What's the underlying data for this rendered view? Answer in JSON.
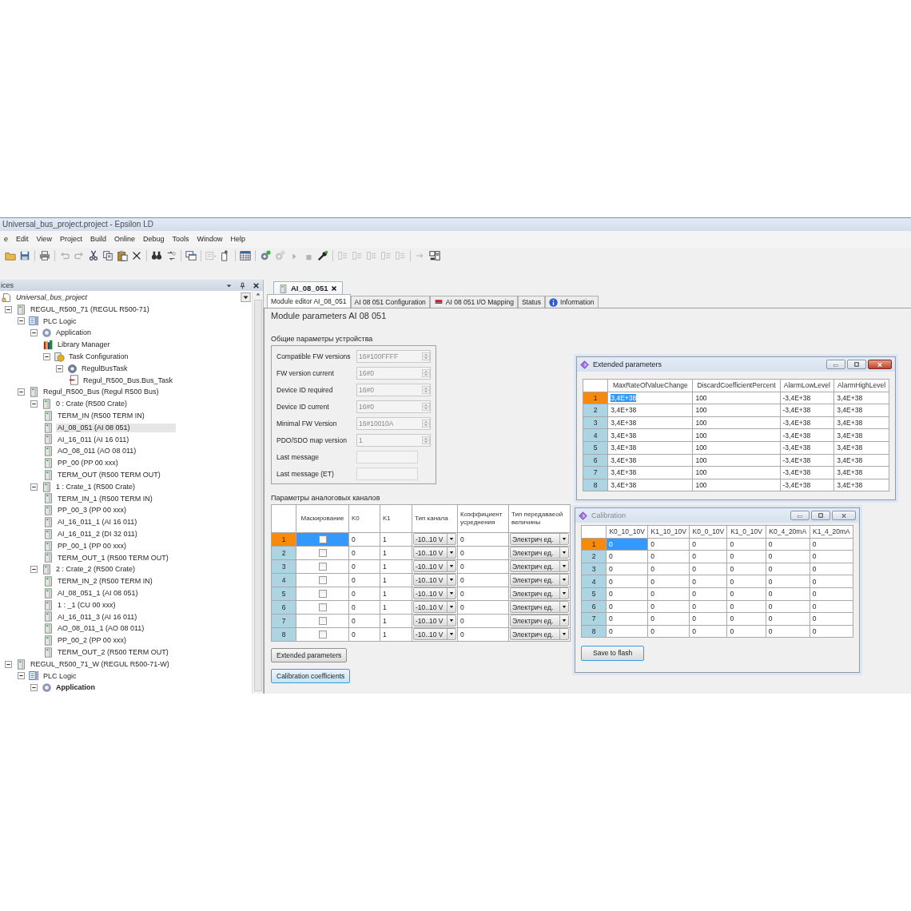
{
  "window": {
    "title": "Universal_bus_project.project - Epsilon LD"
  },
  "menu": [
    "e",
    "Edit",
    "View",
    "Project",
    "Build",
    "Online",
    "Debug",
    "Tools",
    "Window",
    "Help"
  ],
  "toolbar": [
    {
      "kind": "open",
      "disabled": false
    },
    {
      "kind": "save",
      "disabled": false
    },
    {
      "kind": "sep"
    },
    {
      "kind": "print",
      "disabled": false
    },
    {
      "kind": "sep"
    },
    {
      "kind": "undo",
      "disabled": true
    },
    {
      "kind": "redo",
      "disabled": true
    },
    {
      "kind": "cut",
      "disabled": false
    },
    {
      "kind": "copy",
      "disabled": false
    },
    {
      "kind": "paste",
      "disabled": false
    },
    {
      "kind": "delete",
      "disabled": false
    },
    {
      "kind": "sep"
    },
    {
      "kind": "find",
      "disabled": false
    },
    {
      "kind": "replace",
      "disabled": false
    },
    {
      "kind": "sep"
    },
    {
      "kind": "windows",
      "disabled": false
    },
    {
      "kind": "sep"
    },
    {
      "kind": "listdrop",
      "disabled": true
    },
    {
      "kind": "export",
      "disabled": false
    },
    {
      "kind": "sep"
    },
    {
      "kind": "grid",
      "disabled": false
    },
    {
      "kind": "sep"
    },
    {
      "kind": "build",
      "disabled": false
    },
    {
      "kind": "gear",
      "disabled": true
    },
    {
      "kind": "run",
      "disabled": true
    },
    {
      "kind": "stop",
      "disabled": true
    },
    {
      "kind": "wrench",
      "disabled": false
    },
    {
      "kind": "sep"
    },
    {
      "kind": "outline",
      "disabled": true
    },
    {
      "kind": "outline",
      "disabled": true
    },
    {
      "kind": "outline",
      "disabled": true
    },
    {
      "kind": "outline",
      "disabled": true
    },
    {
      "kind": "outline",
      "disabled": true
    },
    {
      "kind": "sep"
    },
    {
      "kind": "step",
      "disabled": true
    },
    {
      "kind": "network",
      "disabled": false
    }
  ],
  "devices_panel": {
    "title": "ices",
    "tree": [
      {
        "label": "Universal_bus_project",
        "kind": "project",
        "selected": false,
        "children": [
          {
            "label": "REGUL_R500_71 (REGUL R500-71)",
            "kind": "device",
            "selected": false,
            "expanded": true,
            "children": [
              {
                "label": "PLC Logic",
                "kind": "plc-logic",
                "selected": false,
                "expanded": true,
                "children": [
                  {
                    "label": "Application",
                    "kind": "application",
                    "selected": false,
                    "expanded": true,
                    "children": [
                      {
                        "label": "Library Manager",
                        "kind": "library",
                        "selected": false
                      },
                      {
                        "label": "Task Configuration",
                        "kind": "task-config",
                        "selected": false,
                        "expanded": true,
                        "children": [
                          {
                            "label": "RegulBusTask",
                            "kind": "task",
                            "selected": false,
                            "expanded": true,
                            "children": [
                              {
                                "label": "Regul_R500_Bus.Bus_Task",
                                "kind": "task-call",
                                "selected": false
                              }
                            ]
                          }
                        ]
                      }
                    ]
                  }
                ]
              },
              {
                "label": "Regul_R500_Bus (Regul R500 Bus)",
                "kind": "device",
                "selected": false,
                "expanded": true,
                "children": [
                  {
                    "label": "0 : Crate (R500 Crate)",
                    "kind": "device",
                    "selected": false,
                    "expanded": true,
                    "children": [
                      {
                        "label": "TERM_IN (R500 TERM IN)",
                        "kind": "device",
                        "selected": false
                      },
                      {
                        "label": "AI_08_051 (AI 08 051)",
                        "kind": "device",
                        "selected": true
                      },
                      {
                        "label": "AI_16_011 (AI 16 011)",
                        "kind": "device",
                        "selected": false
                      },
                      {
                        "label": "AO_08_011 (AO 08 011)",
                        "kind": "device",
                        "selected": false
                      },
                      {
                        "label": "PP_00 (PP 00 xxx)",
                        "kind": "device",
                        "selected": false
                      },
                      {
                        "label": "TERM_OUT (R500 TERM OUT)",
                        "kind": "device",
                        "selected": false
                      }
                    ]
                  },
                  {
                    "label": "1 : Crate_1 (R500 Crate)",
                    "kind": "device",
                    "selected": false,
                    "expanded": true,
                    "children": [
                      {
                        "label": "TERM_IN_1 (R500 TERM IN)",
                        "kind": "device",
                        "selected": false
                      },
                      {
                        "label": "PP_00_3 (PP 00 xxx)",
                        "kind": "device",
                        "selected": false
                      },
                      {
                        "label": "AI_16_011_1 (AI 16 011)",
                        "kind": "device",
                        "selected": false
                      },
                      {
                        "label": "AI_16_011_2 (DI 32 011)",
                        "kind": "device",
                        "selected": false
                      },
                      {
                        "label": "PP_00_1 (PP 00 xxx)",
                        "kind": "device",
                        "selected": false
                      },
                      {
                        "label": "TERM_OUT_1 (R500 TERM OUT)",
                        "kind": "device",
                        "selected": false
                      }
                    ]
                  },
                  {
                    "label": "2 : Crate_2 (R500 Crate)",
                    "kind": "device",
                    "selected": false,
                    "expanded": true,
                    "children": [
                      {
                        "label": "TERM_IN_2 (R500 TERM IN)",
                        "kind": "device",
                        "selected": false
                      },
                      {
                        "label": "AI_08_051_1 (AI 08 051)",
                        "kind": "device",
                        "selected": false
                      },
                      {
                        "label": "1 : _1 (CU 00 xxx)",
                        "kind": "device",
                        "selected": false
                      },
                      {
                        "label": "AI_16_011_3 (AI 16 011)",
                        "kind": "device",
                        "selected": false
                      },
                      {
                        "label": "AO_08_011_1 (AO 08 011)",
                        "kind": "device",
                        "selected": false
                      },
                      {
                        "label": "PP_00_2 (PP 00 xxx)",
                        "kind": "device",
                        "selected": false
                      },
                      {
                        "label": "TERM_OUT_2 (R500 TERM OUT)",
                        "kind": "device",
                        "selected": false
                      }
                    ]
                  }
                ]
              }
            ]
          },
          {
            "label": "REGUL_R500_71_W (REGUL R500-71-W)",
            "kind": "device",
            "selected": false,
            "expanded": true,
            "children": [
              {
                "label": "PLC Logic",
                "kind": "plc-logic",
                "selected": false,
                "expanded": true,
                "children": [
                  {
                    "label": "Application",
                    "kind": "application",
                    "selected": false,
                    "expanded": true,
                    "active": true
                  }
                ]
              }
            ]
          }
        ]
      }
    ]
  },
  "editor": {
    "tab": {
      "label": "AI_08_051"
    },
    "subtabs": [
      {
        "label": "Module editor AI_08_051",
        "kind": "plain",
        "selected": true
      },
      {
        "label": "AI 08 051 Configuration",
        "kind": "plain",
        "selected": false
      },
      {
        "label": "AI 08 051 I/O Mapping",
        "kind": "mapping",
        "selected": false
      },
      {
        "label": "Status",
        "kind": "plain",
        "selected": false
      },
      {
        "label": "Information",
        "kind": "info",
        "selected": false
      }
    ],
    "heading": "Module parameters AI 08 051",
    "general": {
      "title": "Общие параметры устройства",
      "fields": [
        {
          "label": "Compatible FW versions",
          "value": "16#100FFFF",
          "kind": "spin"
        },
        {
          "label": "FW version current",
          "value": "16#0",
          "kind": "spin"
        },
        {
          "label": "Device ID required",
          "value": "16#0",
          "kind": "spin"
        },
        {
          "label": "Device ID current",
          "value": "16#0",
          "kind": "spin"
        },
        {
          "label": "Minimal FW Version",
          "value": "16#10010A",
          "kind": "spin"
        },
        {
          "label": "PDO/SDO map version",
          "value": "1",
          "kind": "spin"
        },
        {
          "label": "Last message",
          "kind": "text"
        },
        {
          "label": "Last message (ET)",
          "kind": "text"
        }
      ]
    },
    "channels": {
      "title": "Параметры аналоговых каналов",
      "columns": [
        "Маскирование",
        "K0",
        "K1",
        "Тип канала",
        "Коэффициент усреднения",
        "Тип передаваеой величины"
      ],
      "rows": [
        {
          "number": "1",
          "selected": true,
          "masked": false,
          "k0": "0",
          "k1": "1",
          "channel_type": "-10..10 V",
          "averaging": "0",
          "value_type": "Электрич ед."
        },
        {
          "number": "2",
          "selected": false,
          "masked": false,
          "k0": "0",
          "k1": "1",
          "channel_type": "-10..10 V",
          "averaging": "0",
          "value_type": "Электрич ед."
        },
        {
          "number": "3",
          "selected": false,
          "masked": false,
          "k0": "0",
          "k1": "1",
          "channel_type": "-10..10 V",
          "averaging": "0",
          "value_type": "Электрич ед."
        },
        {
          "number": "4",
          "selected": false,
          "masked": false,
          "k0": "0",
          "k1": "1",
          "channel_type": "-10..10 V",
          "averaging": "0",
          "value_type": "Электрич ед."
        },
        {
          "number": "5",
          "selected": false,
          "masked": false,
          "k0": "0",
          "k1": "1",
          "channel_type": "-10..10 V",
          "averaging": "0",
          "value_type": "Электрич ед."
        },
        {
          "number": "6",
          "selected": false,
          "masked": false,
          "k0": "0",
          "k1": "1",
          "channel_type": "-10..10 V",
          "averaging": "0",
          "value_type": "Электрич ед."
        },
        {
          "number": "7",
          "selected": false,
          "masked": false,
          "k0": "0",
          "k1": "1",
          "channel_type": "-10..10 V",
          "averaging": "0",
          "value_type": "Электрич ед."
        },
        {
          "number": "8",
          "selected": false,
          "masked": false,
          "k0": "0",
          "k1": "1",
          "channel_type": "-10..10 V",
          "averaging": "0",
          "value_type": "Электрич ед."
        }
      ]
    },
    "buttons": [
      {
        "label": "Extended parameters",
        "focused": false
      },
      {
        "label": "Calibration coefficients",
        "focused": true
      }
    ]
  },
  "extended_window": {
    "title": "Extended parameters",
    "active": true,
    "columns": [
      "MaxRateOfValueChange",
      "DiscardCoefficientPercent",
      "AlarmLowLevel",
      "AlarmHighLevel"
    ],
    "rows": [
      {
        "number": "1",
        "selected": true,
        "cells": [
          "3,4E+38",
          "100",
          "-3,4E+38",
          "3,4E+38"
        ]
      },
      {
        "number": "2",
        "selected": false,
        "cells": [
          "3,4E+38",
          "100",
          "-3,4E+38",
          "3,4E+38"
        ]
      },
      {
        "number": "3",
        "selected": false,
        "cells": [
          "3,4E+38",
          "100",
          "-3,4E+38",
          "3,4E+38"
        ]
      },
      {
        "number": "4",
        "selected": false,
        "cells": [
          "3,4E+38",
          "100",
          "-3,4E+38",
          "3,4E+38"
        ]
      },
      {
        "number": "5",
        "selected": false,
        "cells": [
          "3,4E+38",
          "100",
          "-3,4E+38",
          "3,4E+38"
        ]
      },
      {
        "number": "6",
        "selected": false,
        "cells": [
          "3,4E+38",
          "100",
          "-3,4E+38",
          "3,4E+38"
        ]
      },
      {
        "number": "7",
        "selected": false,
        "cells": [
          "3,4E+38",
          "100",
          "-3,4E+38",
          "3,4E+38"
        ]
      },
      {
        "number": "8",
        "selected": false,
        "cells": [
          "3,4E+38",
          "100",
          "-3,4E+38",
          "3,4E+38"
        ]
      }
    ]
  },
  "calibration_window": {
    "title": "Calibration",
    "active": false,
    "columns": [
      "K0_10_10V",
      "K1_10_10V",
      "K0_0_10V",
      "K1_0_10V",
      "K0_4_20mA",
      "K1_4_20mA"
    ],
    "rows": [
      {
        "number": "1",
        "selected": true,
        "cells": [
          "0",
          "0",
          "0",
          "0",
          "0",
          "0"
        ]
      },
      {
        "number": "2",
        "selected": false,
        "cells": [
          "0",
          "0",
          "0",
          "0",
          "0",
          "0"
        ]
      },
      {
        "number": "3",
        "selected": false,
        "cells": [
          "0",
          "0",
          "0",
          "0",
          "0",
          "0"
        ]
      },
      {
        "number": "4",
        "selected": false,
        "cells": [
          "0",
          "0",
          "0",
          "0",
          "0",
          "0"
        ]
      },
      {
        "number": "5",
        "selected": false,
        "cells": [
          "0",
          "0",
          "0",
          "0",
          "0",
          "0"
        ]
      },
      {
        "number": "6",
        "selected": false,
        "cells": [
          "0",
          "0",
          "0",
          "0",
          "0",
          "0"
        ]
      },
      {
        "number": "7",
        "selected": false,
        "cells": [
          "0",
          "0",
          "0",
          "0",
          "0",
          "0"
        ]
      },
      {
        "number": "8",
        "selected": false,
        "cells": [
          "0",
          "0",
          "0",
          "0",
          "0",
          "0"
        ]
      }
    ],
    "button": "Save to flash"
  }
}
